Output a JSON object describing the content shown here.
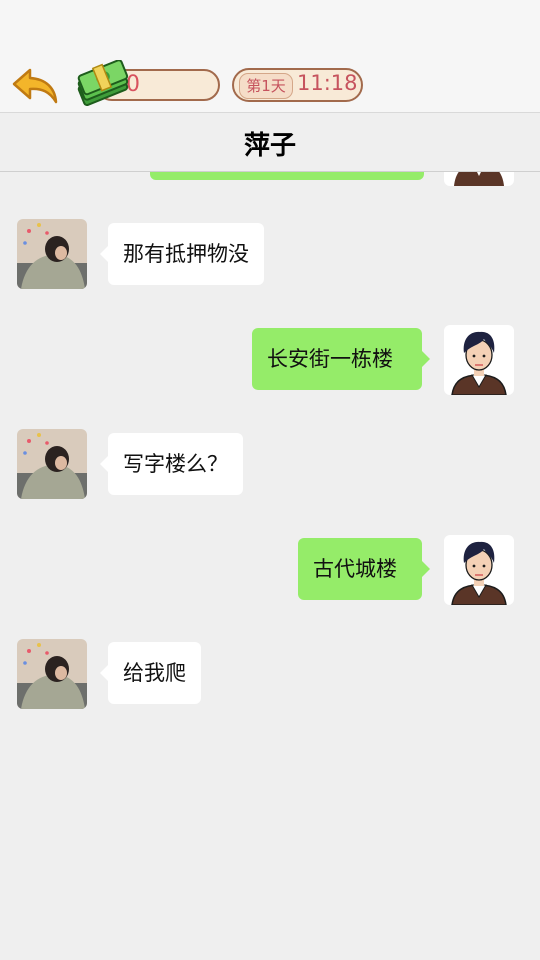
{
  "header": {
    "money": "0",
    "day": "第1天",
    "time": "11:18"
  },
  "chat": {
    "title": "萍子",
    "messages": [
      {
        "from": "contact",
        "text": "那有抵押物没"
      },
      {
        "from": "me",
        "text": "长安街一栋楼"
      },
      {
        "from": "contact",
        "text": "写字楼么？"
      },
      {
        "from": "me",
        "text": "古代城楼"
      },
      {
        "from": "contact",
        "text": "给我爬"
      }
    ]
  },
  "colors": {
    "chat_bg": "#efefef",
    "incoming_bubble": "#ffffff",
    "outgoing_bubble": "#95ec69",
    "accent_text": "#d8525f",
    "pill_border": "#a26a4c"
  },
  "icons": [
    "back-arrow-icon",
    "cash-stack-icon"
  ]
}
